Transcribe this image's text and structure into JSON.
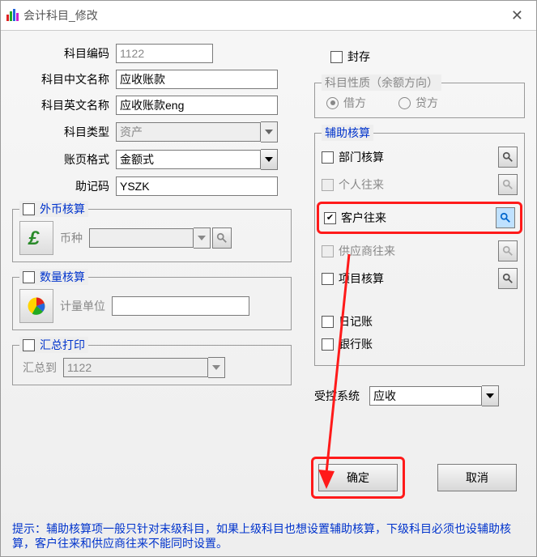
{
  "window": {
    "title": "会计科目_修改"
  },
  "labels": {
    "code": "科目编码",
    "cn_name": "科目中文名称",
    "en_name": "科目英文名称",
    "type": "科目类型",
    "page_fmt": "账页格式",
    "mnemonic": "助记码",
    "currency": "币种",
    "unit": "计量单位",
    "sum_to": "汇总到",
    "seal": "封存",
    "nature_group": "科目性质（余额方向）",
    "debit": "借方",
    "credit": "贷方",
    "aux_group": "辅助核算",
    "dept": "部门核算",
    "person": "个人往来",
    "customer": "客户往来",
    "supplier": "供应商往来",
    "project": "项目核算",
    "journal": "日记账",
    "bank": "银行账",
    "ctrl_sys": "受控系统",
    "fx_group": "外币核算",
    "qty_group": "数量核算",
    "sum_group": "汇总打印",
    "ok": "确定",
    "cancel": "取消"
  },
  "values": {
    "code": "1122",
    "cn_name": "应收账款",
    "en_name": "应收账款eng",
    "type": "资产",
    "page_fmt": "金额式",
    "mnemonic": "YSZK",
    "sum_to": "1122",
    "ctrl_sys": "应收"
  },
  "tip": "提示：辅助核算项一般只针对末级科目，如果上级科目也想设置辅助核算，下级科目必须也设辅助核算，客户往来和供应商往来不能同时设置。"
}
